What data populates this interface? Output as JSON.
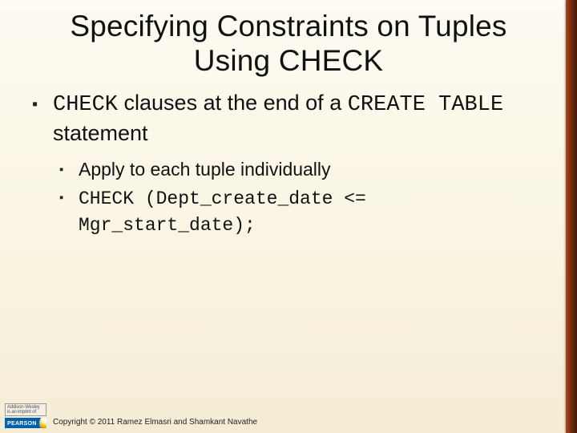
{
  "title_line1": "Specifying Constraints on Tuples",
  "title_line2": "Using CHECK",
  "bullet1": {
    "t1_code": "CHECK",
    "t2": " clauses at the end of a ",
    "t3_code": "CREATE TABLE",
    "t4": " statement"
  },
  "sub1": "Apply to each tuple individually",
  "sub2_code": "CHECK (Dept_create_date <= Mgr_start_date);",
  "publisher": {
    "imprint_line1": "Addison-Wesley",
    "imprint_line2": "is an imprint of",
    "brand": "PEARSON"
  },
  "copyright": "Copyright © 2011 Ramez Elmasri and Shamkant Navathe"
}
